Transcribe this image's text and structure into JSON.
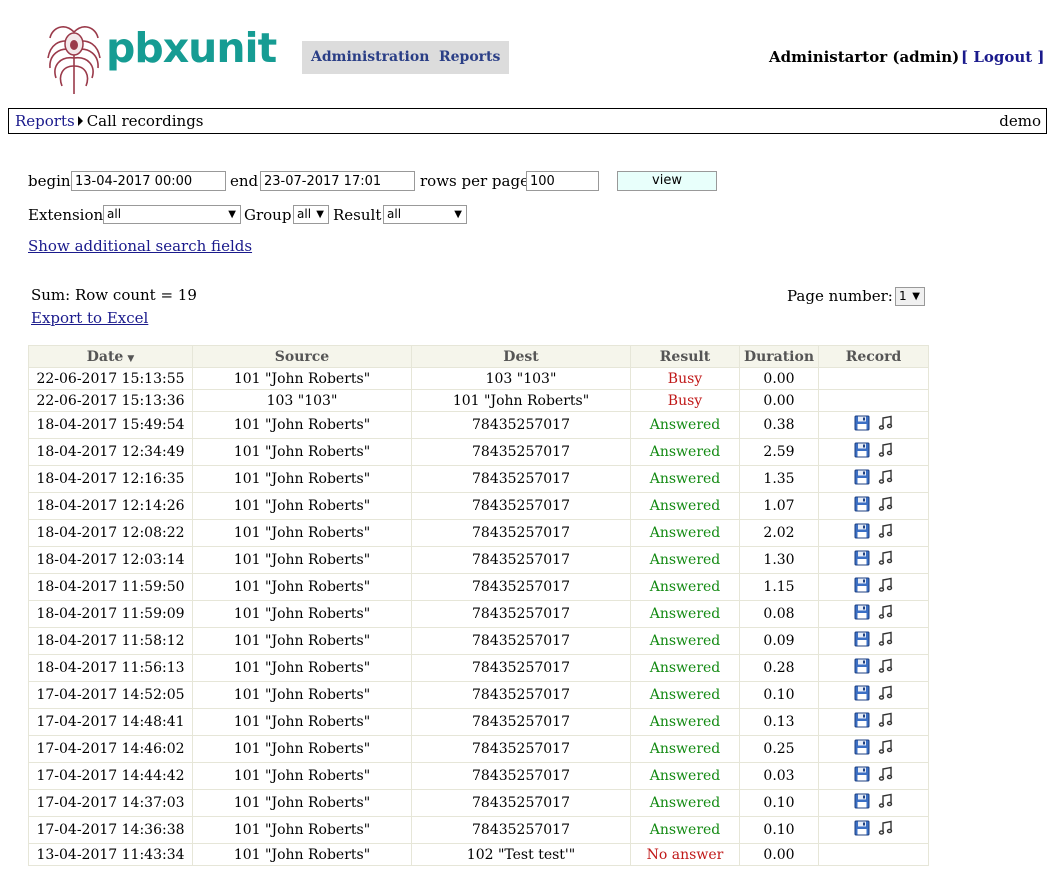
{
  "header": {
    "logo_text": "pbxunit",
    "menu": [
      {
        "label": "Administration"
      },
      {
        "label": "Reports"
      }
    ],
    "user_label": "Administartor (admin)",
    "logout_label": "[ Logout ]"
  },
  "breadcrumb": {
    "parent": "Reports",
    "current": "Call recordings",
    "right": "demo"
  },
  "filters": {
    "begin_label": "begin",
    "begin_value": "13-04-2017 00:00",
    "end_label": "end",
    "end_value": "23-07-2017 17:01",
    "rows_label": "rows per page",
    "rows_value": "100",
    "view_button": "view",
    "extension_label": "Extension",
    "extension_value": "all",
    "group_label": "Group",
    "group_value": "all",
    "result_label": "Result",
    "result_value": "all",
    "show_more": "Show additional search fields"
  },
  "summary": {
    "sum_text": "Sum: Row count = 19",
    "export_label": "Export to Excel",
    "page_label": "Page number:",
    "page_value": "1"
  },
  "table": {
    "columns": [
      "Date",
      "Source",
      "Dest",
      "Result",
      "Duration",
      "Record"
    ],
    "rows": [
      {
        "date": "22-06-2017 15:13:55",
        "source": "101 \"John Roberts\"",
        "dest": "103 \"103\"",
        "result": "Busy",
        "duration": "0.00",
        "record": false
      },
      {
        "date": "22-06-2017 15:13:36",
        "source": "103 \"103\"",
        "dest": "101 \"John Roberts\"",
        "result": "Busy",
        "duration": "0.00",
        "record": false
      },
      {
        "date": "18-04-2017 15:49:54",
        "source": "101 \"John Roberts\"",
        "dest": "78435257017",
        "result": "Answered",
        "duration": "0.38",
        "record": true
      },
      {
        "date": "18-04-2017 12:34:49",
        "source": "101 \"John Roberts\"",
        "dest": "78435257017",
        "result": "Answered",
        "duration": "2.59",
        "record": true
      },
      {
        "date": "18-04-2017 12:16:35",
        "source": "101 \"John Roberts\"",
        "dest": "78435257017",
        "result": "Answered",
        "duration": "1.35",
        "record": true
      },
      {
        "date": "18-04-2017 12:14:26",
        "source": "101 \"John Roberts\"",
        "dest": "78435257017",
        "result": "Answered",
        "duration": "1.07",
        "record": true
      },
      {
        "date": "18-04-2017 12:08:22",
        "source": "101 \"John Roberts\"",
        "dest": "78435257017",
        "result": "Answered",
        "duration": "2.02",
        "record": true
      },
      {
        "date": "18-04-2017 12:03:14",
        "source": "101 \"John Roberts\"",
        "dest": "78435257017",
        "result": "Answered",
        "duration": "1.30",
        "record": true
      },
      {
        "date": "18-04-2017 11:59:50",
        "source": "101 \"John Roberts\"",
        "dest": "78435257017",
        "result": "Answered",
        "duration": "1.15",
        "record": true
      },
      {
        "date": "18-04-2017 11:59:09",
        "source": "101 \"John Roberts\"",
        "dest": "78435257017",
        "result": "Answered",
        "duration": "0.08",
        "record": true
      },
      {
        "date": "18-04-2017 11:58:12",
        "source": "101 \"John Roberts\"",
        "dest": "78435257017",
        "result": "Answered",
        "duration": "0.09",
        "record": true
      },
      {
        "date": "18-04-2017 11:56:13",
        "source": "101 \"John Roberts\"",
        "dest": "78435257017",
        "result": "Answered",
        "duration": "0.28",
        "record": true
      },
      {
        "date": "17-04-2017 14:52:05",
        "source": "101 \"John Roberts\"",
        "dest": "78435257017",
        "result": "Answered",
        "duration": "0.10",
        "record": true
      },
      {
        "date": "17-04-2017 14:48:41",
        "source": "101 \"John Roberts\"",
        "dest": "78435257017",
        "result": "Answered",
        "duration": "0.13",
        "record": true
      },
      {
        "date": "17-04-2017 14:46:02",
        "source": "101 \"John Roberts\"",
        "dest": "78435257017",
        "result": "Answered",
        "duration": "0.25",
        "record": true
      },
      {
        "date": "17-04-2017 14:44:42",
        "source": "101 \"John Roberts\"",
        "dest": "78435257017",
        "result": "Answered",
        "duration": "0.03",
        "record": true
      },
      {
        "date": "17-04-2017 14:37:03",
        "source": "101 \"John Roberts\"",
        "dest": "78435257017",
        "result": "Answered",
        "duration": "0.10",
        "record": true
      },
      {
        "date": "17-04-2017 14:36:38",
        "source": "101 \"John Roberts\"",
        "dest": "78435257017",
        "result": "Answered",
        "duration": "0.10",
        "record": true
      },
      {
        "date": "13-04-2017 11:43:34",
        "source": "101 \"John Roberts\"",
        "dest": "102 \"Test test'\"",
        "result": "No answer",
        "duration": "0.00",
        "record": false
      }
    ]
  },
  "colors": {
    "brand": "#169c93",
    "logo_feather": "#9a3a4a",
    "link": "#1a1a8c",
    "answered": "#128a12",
    "failed": "#c01818",
    "header_bg": "#f5f5eb"
  }
}
